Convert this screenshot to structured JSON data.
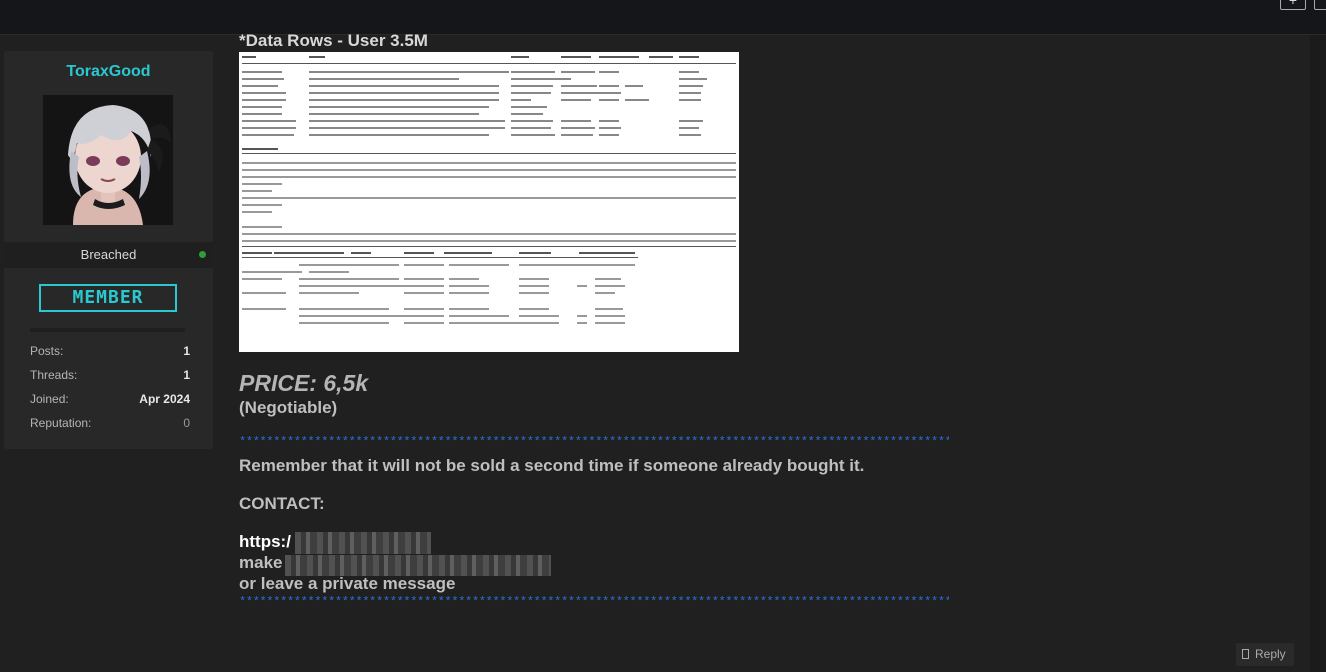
{
  "window": {
    "top_buttons": [
      "+",
      ""
    ]
  },
  "author": {
    "username": "ToraxGood",
    "rank": "Breached",
    "badge": "MEMBER",
    "stats": [
      {
        "label": "Posts:",
        "value": "1"
      },
      {
        "label": "Threads:",
        "value": "1"
      },
      {
        "label": "Joined:",
        "value": "Apr 2024"
      },
      {
        "label": "Reputation:",
        "value": "0"
      }
    ]
  },
  "post": {
    "heading": "*Data Rows - User 3.5M",
    "price": "PRICE: 6,5k",
    "negotiable": "(Negotiable)",
    "separator": "**************************************************************************************************************************",
    "remember": "Remember that it will not be sold a second time if someone already bought it.",
    "contact_heading": "CONTACT:",
    "contact_link_prefix": "https:/",
    "contact_line2_prefix": "make",
    "contact_line3": "or leave a private message",
    "reply_label": "Reply"
  }
}
